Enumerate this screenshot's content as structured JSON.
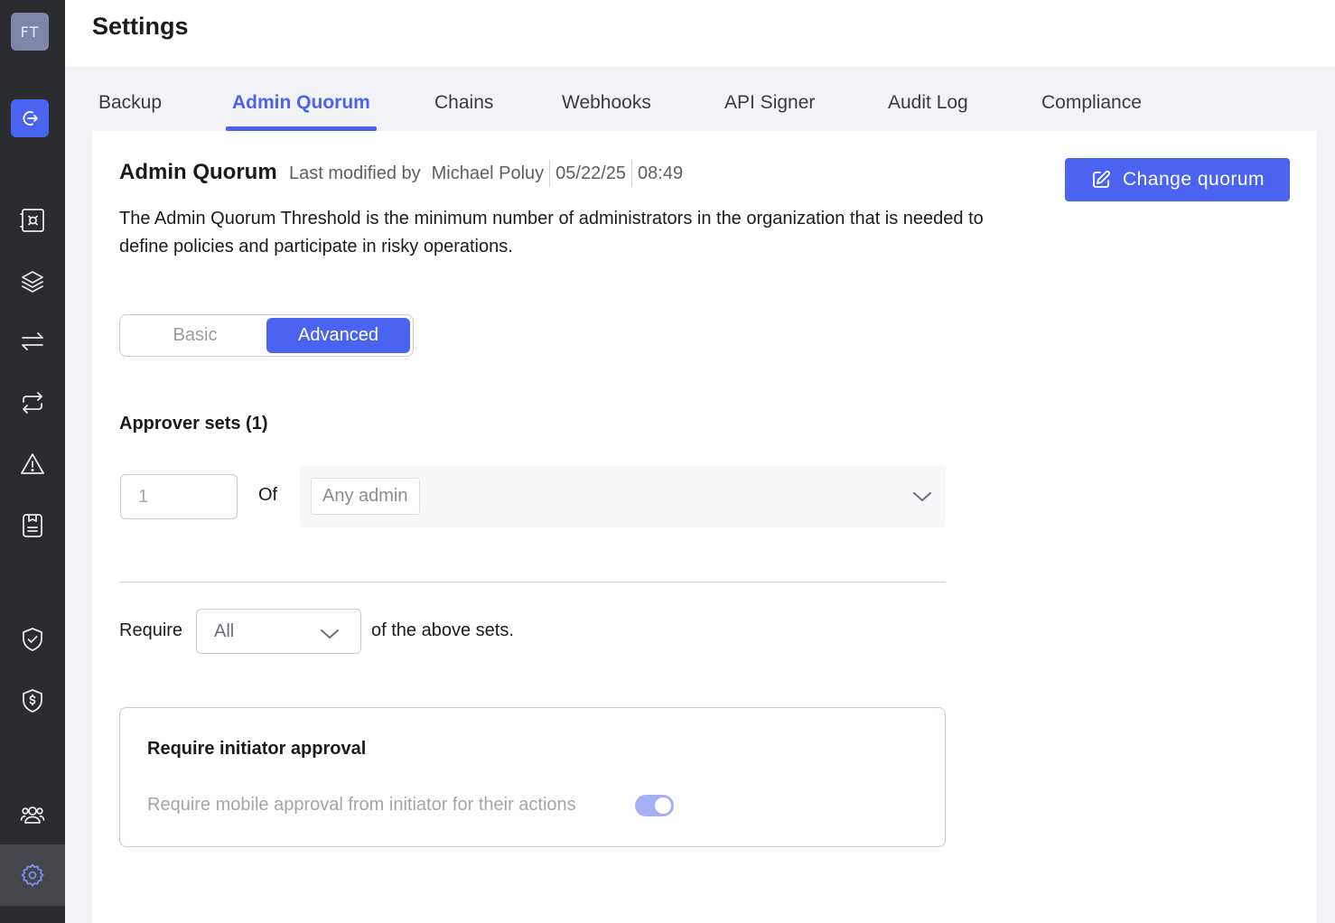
{
  "sidebar": {
    "avatar_initials": "FT",
    "items": [
      {
        "name": "logout",
        "icon": "logout-icon"
      },
      {
        "name": "vault",
        "icon": "vault-icon"
      },
      {
        "name": "assets",
        "icon": "layers-icon"
      },
      {
        "name": "transfers",
        "icon": "transfer-arrows-icon"
      },
      {
        "name": "swap",
        "icon": "repeat-icon"
      },
      {
        "name": "alerts",
        "icon": "warning-icon"
      },
      {
        "name": "policies",
        "icon": "document-badge-icon"
      },
      {
        "name": "security",
        "icon": "shield-check-icon"
      },
      {
        "name": "billing",
        "icon": "shield-dollar-icon"
      },
      {
        "name": "users",
        "icon": "users-icon"
      },
      {
        "name": "settings",
        "icon": "gear-icon"
      }
    ]
  },
  "header": {
    "title": "Settings"
  },
  "tabs": [
    {
      "label": "Backup"
    },
    {
      "label": "Admin Quorum"
    },
    {
      "label": "Chains"
    },
    {
      "label": "Webhooks"
    },
    {
      "label": "API Signer"
    },
    {
      "label": "Audit Log"
    },
    {
      "label": "Compliance"
    }
  ],
  "active_tab": "Admin Quorum",
  "quorum": {
    "title": "Admin Quorum",
    "last_modified_label": "Last modified by",
    "modified_by": "Michael Poluy",
    "date": "05/22/25",
    "time": "08:49",
    "description": "The Admin Quorum Threshold is the minimum number of administrators in the organization that is needed to define policies and participate in risky operations.",
    "change_button_label": "Change quorum",
    "mode": {
      "basic_label": "Basic",
      "advanced_label": "Advanced",
      "selected": "Advanced"
    },
    "approver_sets_title": "Approver sets (1)",
    "approver_set": {
      "count_value": "1",
      "of_label": "Of",
      "selected_group": "Any admin"
    },
    "require": {
      "label": "Require",
      "value": "All",
      "suffix": "of the above sets."
    },
    "initiator": {
      "title": "Require initiator approval",
      "description": "Require mobile approval from initiator for their actions",
      "enabled": true
    }
  },
  "colors": {
    "accent": "#4a63f0",
    "sidebar_bg": "#2b2c30",
    "toggle_disabled_on": "#a5b1f5"
  }
}
